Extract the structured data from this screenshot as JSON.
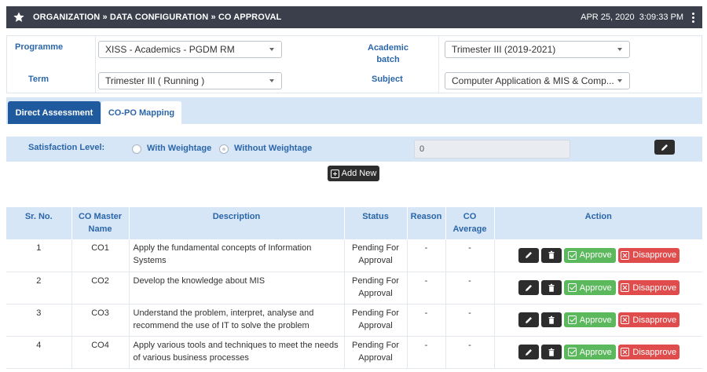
{
  "header": {
    "breadcrumb": "ORGANIZATION » DATA CONFIGURATION » CO APPROVAL",
    "date": "APR 25, 2020",
    "time": "3:09:33 PM",
    "icon": "star-icon"
  },
  "filters": {
    "programme_label": "Programme",
    "programme_value": "XISS - Academics - PGDM RM",
    "academic_batch_label_line1": "Academic",
    "academic_batch_label_line2": "batch",
    "academic_batch_value": "Trimester III (2019-2021)",
    "term_label": "Term",
    "term_value": "Trimester III ( Running )",
    "subject_label": "Subject",
    "subject_value": "Computer Application & MIS & Comp..."
  },
  "tabs": [
    {
      "label": "Direct Assessment",
      "active": true
    },
    {
      "label": "CO-PO Mapping",
      "active": false
    }
  ],
  "satisfaction": {
    "label": "Satisfaction Level:",
    "option_with": "With Weightage",
    "option_without": "Without Weightage",
    "selected": "Without Weightage",
    "value": "0"
  },
  "add_new_label": "Add New",
  "table": {
    "headers": {
      "sr_no": "Sr. No.",
      "co_master_line1": "CO Master",
      "co_master_line2": "Name",
      "description": "Description",
      "status": "Status",
      "reason": "Reason",
      "co_average_line1": "CO",
      "co_average_line2": "Average",
      "action": "Action"
    },
    "rows": [
      {
        "sr": "1",
        "co": "CO1",
        "description": "Apply the fundamental concepts of Information Systems",
        "status_line1": "Pending For",
        "status_line2": "Approval",
        "reason": "-",
        "average": "-"
      },
      {
        "sr": "2",
        "co": "CO2",
        "description": "Develop the knowledge about MIS",
        "status_line1": "Pending For",
        "status_line2": "Approval",
        "reason": "-",
        "average": "-"
      },
      {
        "sr": "3",
        "co": "CO3",
        "description": "Understand the problem, interpret, analyse and recommend the use of IT to solve the problem",
        "status_line1": "Pending For",
        "status_line2": "Approval",
        "reason": "-",
        "average": "-"
      },
      {
        "sr": "4",
        "co": "CO4",
        "description": "Apply various tools and techniques to meet the needs of various business processes",
        "status_line1": "Pending For",
        "status_line2": "Approval",
        "reason": "-",
        "average": "-"
      }
    ],
    "approve_label": "Approve",
    "disapprove_label": "Disapprove"
  },
  "colors": {
    "topbar": "#3a3f4b",
    "accent_blue": "#2b66a8",
    "active_tab": "#1f5a9e",
    "light_blue": "#d6e6f7",
    "approve_green": "#5cb85c",
    "disapprove_red": "#e04b4b"
  }
}
